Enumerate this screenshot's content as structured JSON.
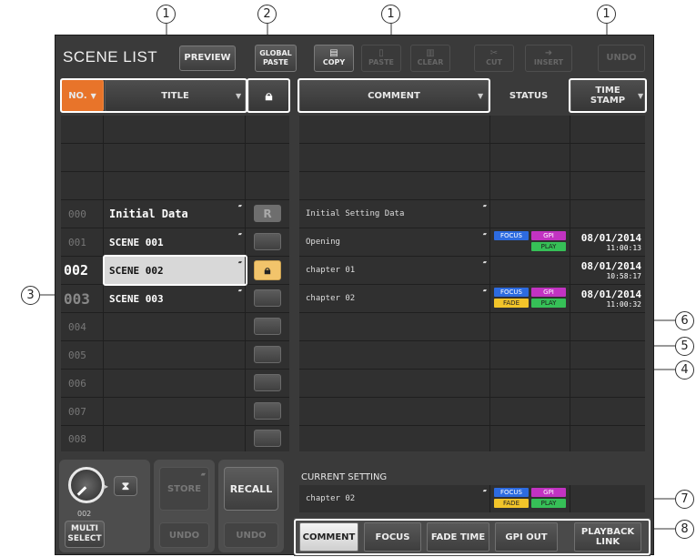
{
  "header": {
    "title": "SCENE LIST",
    "preview_label": "PREVIEW",
    "global_paste_label_1": "GLOBAL",
    "global_paste_label_2": "PASTE",
    "copy_label": "COPY",
    "paste_label": "PASTE",
    "clear_label": "CLEAR",
    "cut_label": "CUT",
    "insert_label": "INSERT",
    "undo_label": "UNDO"
  },
  "columns": {
    "no": "NO.",
    "title": "TITLE",
    "comment": "COMMENT",
    "status": "STATUS",
    "time_stamp_1": "TIME",
    "time_stamp_2": "STAMP"
  },
  "rows": [
    {
      "no": "000",
      "title": "Initial Data",
      "comment": "Initial Setting Data",
      "time": "",
      "time2": ""
    },
    {
      "no": "001",
      "title": "SCENE 001",
      "comment": "Opening",
      "time": "08/01/2014",
      "time2": "11:00:13"
    },
    {
      "no": "002",
      "title": "SCENE 002",
      "comment": "chapter 01",
      "time": "08/01/2014",
      "time2": "10:58:17"
    },
    {
      "no": "003",
      "title": "SCENE 003",
      "comment": "chapter 02",
      "time": "08/01/2014",
      "time2": "11:00:32"
    },
    {
      "no": "004",
      "title": "",
      "comment": "",
      "time": "",
      "time2": ""
    },
    {
      "no": "005",
      "title": "",
      "comment": "",
      "time": "",
      "time2": ""
    },
    {
      "no": "006",
      "title": "",
      "comment": "",
      "time": "",
      "time2": ""
    },
    {
      "no": "007",
      "title": "",
      "comment": "",
      "time": "",
      "time2": ""
    },
    {
      "no": "008",
      "title": "",
      "comment": "",
      "time": "",
      "time2": ""
    }
  ],
  "rbutton_label": "R",
  "status_badges": {
    "focus": "FOCUS",
    "gpi": "GPI",
    "play": "PLAY",
    "fade": "FADE"
  },
  "current_setting": {
    "label": "CURRENT SETTING",
    "comment": "chapter 02"
  },
  "bottom": {
    "knob_value": "002",
    "multi_select_1": "MULTI",
    "multi_select_2": "SELECT",
    "store": "STORE",
    "recall": "RECALL",
    "undo": "UNDO"
  },
  "tabs": [
    "COMMENT",
    "FOCUS",
    "FADE TIME",
    "GPI OUT",
    "PLAYBACK",
    "LINK"
  ],
  "callouts": [
    "1",
    "2",
    "1",
    "1",
    "3",
    "6",
    "5",
    "4",
    "7",
    "8"
  ],
  "colors": {
    "lock_on": "#f2c46b",
    "focus": "#2d6be0",
    "gpi": "#c233c2",
    "play": "#36c057",
    "fade": "#f2c42a",
    "no_header": "#e8742a"
  }
}
